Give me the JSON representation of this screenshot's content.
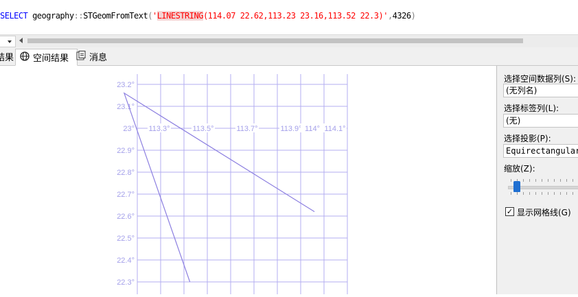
{
  "editor": {
    "kw_select": "SELECT",
    "word_geography": " geography",
    "scope": "::",
    "fn_name": "STGeomFromText",
    "paren_open": "(",
    "quote_open": "'",
    "wkt_type": "LINESTRING",
    "wkt_coords": "(114.07 22.62,113.23 23.16,113.52 22.3)",
    "quote_close": "'",
    "comma": ",",
    "srid": "4326",
    "paren_close": ")"
  },
  "tabs": [
    {
      "label": "结果"
    },
    {
      "label": "空间结果"
    },
    {
      "label": "消息"
    }
  ],
  "side_panel": {
    "spatial_column_label": "选择空间数据列(S):",
    "spatial_column_value": "(无列名)",
    "label_column_label": "选择标签列(L):",
    "label_column_value": "(无)",
    "projection_label": "选择投影(P):",
    "projection_value": "Equirectangular",
    "zoom_label": "缩放(Z):",
    "zoom_level": 0.05,
    "gridlines_label": "显示网格线(G)",
    "gridlines_checked": true
  },
  "chart_data": {
    "type": "line",
    "projection": "Equirectangular",
    "grid": true,
    "x_tick_labels": [
      "113.3°",
      "113.5°",
      "113.7°",
      "113.9°",
      "114°",
      "114.1°"
    ],
    "y_tick_labels": [
      "23.2°",
      "23.1°",
      "23°",
      "22.9°",
      "22.8°",
      "22.7°",
      "22.6°",
      "22.5°",
      "22.4°",
      "22.3°"
    ],
    "xlim": [
      113.2,
      114.15
    ],
    "ylim": [
      22.27,
      23.24
    ],
    "series": [
      {
        "points": [
          [
            114.07,
            22.62
          ],
          [
            113.23,
            23.16
          ],
          [
            113.52,
            22.3
          ]
        ]
      }
    ],
    "colors": {
      "line": "#8c7fe0",
      "grid": "#b3aef0",
      "tick": "#a4a0ea"
    }
  }
}
